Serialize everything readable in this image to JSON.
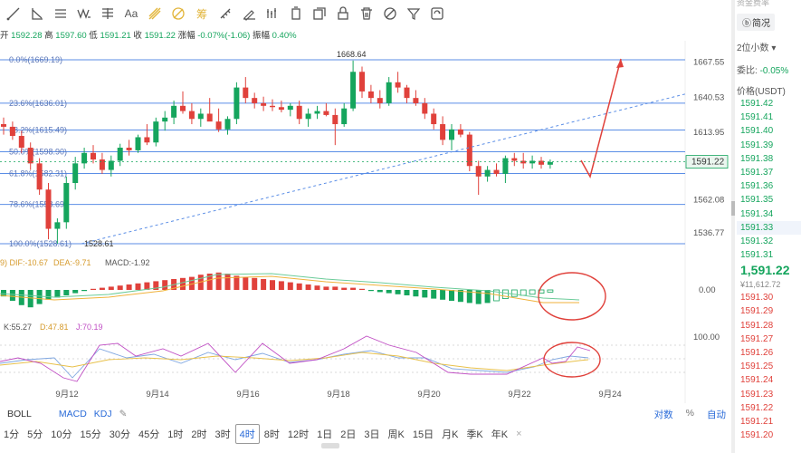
{
  "toolbar": {
    "tools": [
      "line-tool",
      "ray-tool",
      "horizontal-line-tool",
      "wave-tool",
      "parallel-channel-tool",
      "text-tool",
      "fibonacci-tool",
      "gann-tool",
      "pattern-tool",
      "ruler-tool",
      "brush-tool",
      "bar-pattern-tool",
      "long-position-tool",
      "copy-tool",
      "lock-tool",
      "trash-tool",
      "eye-tool",
      "filter-tool",
      "settings-tool"
    ],
    "text_label": "Aa",
    "active": [
      "fibonacci-tool",
      "gann-tool",
      "pattern-tool"
    ]
  },
  "ohlc": {
    "open_label": "开",
    "open": "1592.28",
    "high_label": "高",
    "high": "1597.60",
    "low_label": "低",
    "low": "1591.21",
    "close_label": "收",
    "close": "1591.22",
    "change_label": "涨幅",
    "change": "-0.07%(-1.06)",
    "amp_label": "振幅",
    "amp": "0.40%"
  },
  "fib": [
    {
      "label": "0.0%(1669.19)",
      "price": 1669.19
    },
    {
      "label": "23.6%(1636.01)",
      "price": 1636.01
    },
    {
      "label": "38.2%(1615.49)",
      "price": 1615.49
    },
    {
      "label": "50.0%(1598.90)",
      "price": 1598.9
    },
    {
      "label": "61.8%(1582.31)",
      "price": 1582.31
    },
    {
      "label": "78.6%(1558.69)",
      "price": 1558.69
    },
    {
      "label": "100.0%(1528.61)",
      "price": 1528.61
    }
  ],
  "price_axis": [
    "1667.55",
    "1640.53",
    "1613.95",
    "1591.22",
    "1562.08",
    "1536.77"
  ],
  "current_price": "1591.22",
  "annotations": {
    "high": "1668.64",
    "low": "1528.61"
  },
  "macd_legend": {
    "dif": "DIF:-10.67",
    "dea": "DEA:-9.71",
    "macd": "MACD:-1.92"
  },
  "macd_axis": "0.00",
  "kdj_legend": {
    "k": "K:55.27",
    "d": "D:47.81",
    "j": "J:70.19"
  },
  "kdj_axis": "100.00",
  "x_axis": [
    "9月12",
    "9月14",
    "9月16",
    "9月18",
    "9月20",
    "9月22",
    "9月24"
  ],
  "indicators": {
    "boll": "BOLL",
    "macd": "MACD",
    "kdj": "KDJ"
  },
  "view_options": {
    "log": "对数",
    "percent": "%",
    "auto": "自动"
  },
  "timeframes": [
    "1分",
    "5分",
    "10分",
    "15分",
    "30分",
    "45分",
    "1时",
    "2时",
    "3时",
    "4时",
    "8时",
    "12时",
    "1日",
    "2日",
    "3日",
    "周K",
    "15日",
    "月K",
    "季K",
    "年K"
  ],
  "selected_timeframe": "4时",
  "side": {
    "top_cut": "资金费率",
    "chip": "简况",
    "precision": "2位小数",
    "ratio_label": "委比:",
    "ratio": "-0.05%",
    "price_header": "价格(USDT)",
    "asks": [
      "1591.42",
      "1591.41",
      "1591.40",
      "1591.39",
      "1591.38",
      "1591.37",
      "1591.36",
      "1591.35",
      "1591.34",
      "1591.33",
      "1591.32",
      "1591.31"
    ],
    "last": "1,591.22",
    "last_cny": "¥11,612.72",
    "bids": [
      "1591.30",
      "1591.29",
      "1591.28",
      "1591.27",
      "1591.26",
      "1591.25",
      "1591.24",
      "1591.23",
      "1591.22",
      "1591.21",
      "1591.20"
    ]
  },
  "colors": {
    "up": "#15a55d",
    "down": "#e0413b",
    "fib": "#5b8ee6",
    "accent": "#2a6bd8",
    "dif": "#f0b23b",
    "dea": "#6ccc9a",
    "j": "#c04fc4"
  }
}
